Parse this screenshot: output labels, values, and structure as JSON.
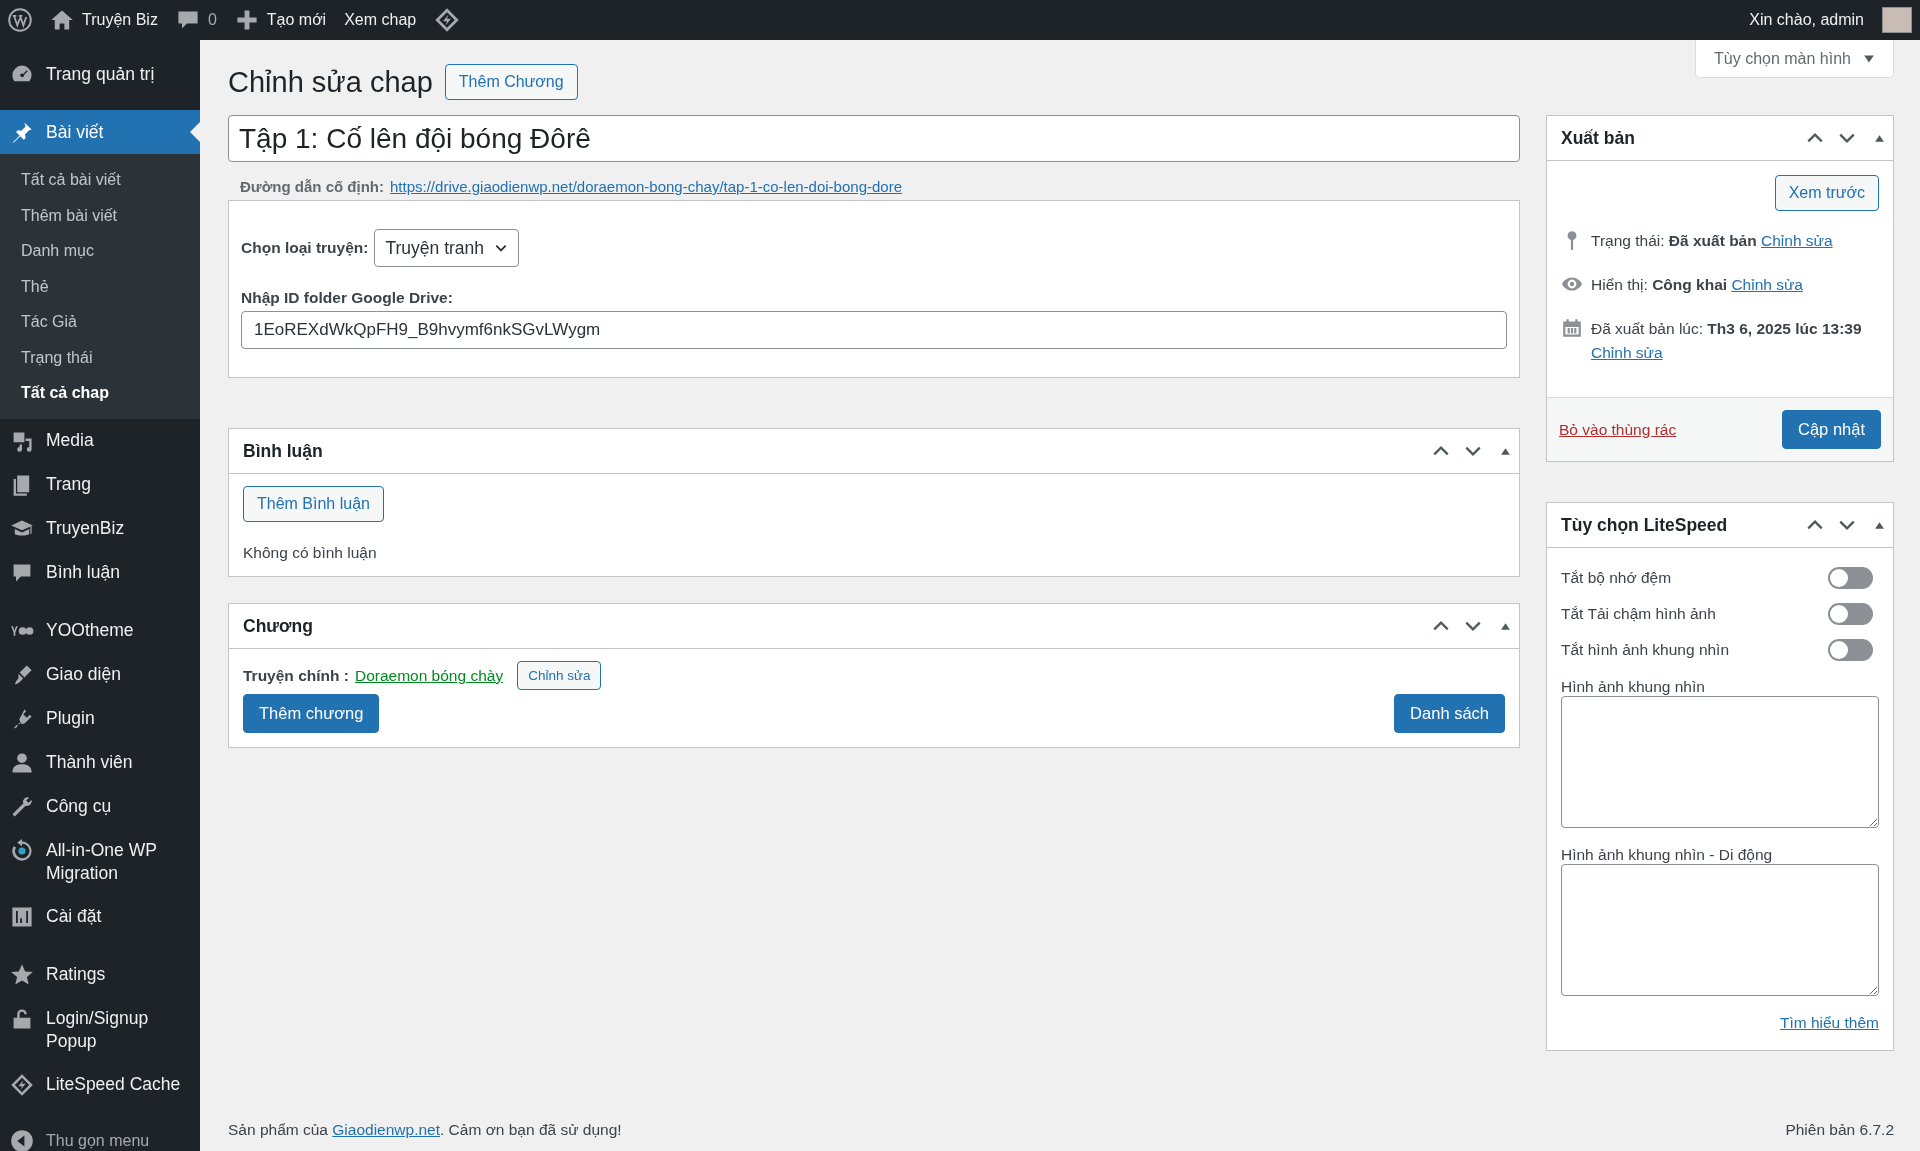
{
  "admin_bar": {
    "items": [
      {
        "label": "Truyện Biz"
      },
      {
        "label": "0"
      },
      {
        "label": "Tạo mới"
      },
      {
        "label": "Xem chap"
      }
    ],
    "greeting": "Xin chào, admin"
  },
  "sidebar": {
    "groups": [
      {
        "items": [
          {
            "label": "Trang quản trị",
            "selected": false
          }
        ]
      },
      {
        "items": [
          {
            "label": "Bài viết",
            "selected": true,
            "children": [
              {
                "label": "Tất cả bài viết",
                "selected": false
              },
              {
                "label": "Thêm bài viết",
                "selected": false
              },
              {
                "label": "Danh mục",
                "selected": false
              },
              {
                "label": "Thẻ",
                "selected": false
              },
              {
                "label": "Tác Giả",
                "selected": false
              },
              {
                "label": "Trạng thái",
                "selected": false
              },
              {
                "label": "Tất cả chap",
                "selected": true
              }
            ]
          },
          {
            "label": "Media",
            "selected": false
          },
          {
            "label": "Trang",
            "selected": false
          },
          {
            "label": "TruyenBiz",
            "selected": false
          },
          {
            "label": "Bình luận",
            "selected": false
          }
        ]
      },
      {
        "items": [
          {
            "label": "YOOtheme",
            "selected": false
          },
          {
            "label": "Giao diện",
            "selected": false
          },
          {
            "label": "Plugin",
            "selected": false
          },
          {
            "label": "Thành viên",
            "selected": false
          },
          {
            "label": "Công cụ",
            "selected": false
          },
          {
            "label": "All-in-One WP Migration",
            "selected": false
          },
          {
            "label": "Cài đặt",
            "selected": false
          }
        ]
      },
      {
        "items": [
          {
            "label": "Ratings",
            "selected": false
          },
          {
            "label": "Login/Signup Popup",
            "selected": false
          },
          {
            "label": "LiteSpeed Cache",
            "selected": false
          }
        ]
      }
    ],
    "collapse": "Thu gọn menu"
  },
  "screen_options": "Tùy chọn màn hình",
  "page": {
    "title": "Chỉnh sửa chap",
    "add_button": "Thêm Chương"
  },
  "post_title": "Tập 1: Cố lên đội bóng Đôrê",
  "permalink": {
    "label": "Đường dẫn cố định:",
    "url": "https://drive.giaodienwp.net/doraemon-bong-chay/tap-1-co-len-doi-bong-dore"
  },
  "custom_fields": {
    "type_label": "Chọn loại truyện:",
    "type_value": "Truyện tranh",
    "drive_label": "Nhập ID folder Google Drive:",
    "drive_value": "1EoREXdWkQpFH9_B9hvymf6nkSGvLWygm"
  },
  "comments_box": {
    "title": "Bình luận",
    "button": "Thêm Bình luận",
    "empty": "Không có bình luận"
  },
  "chapter_box": {
    "title": "Chương",
    "main_label": "Truyện chính :",
    "main_link": "Doraemon bóng chày",
    "edit_button": "Chỉnh sửa",
    "add_button": "Thêm chương",
    "list_button": "Danh sách"
  },
  "publish_box": {
    "title": "Xuất bản",
    "preview": "Xem trước",
    "rows": [
      {
        "text": "Trạng thái: **Đã xuất bản**",
        "link": "Chỉnh sửa"
      },
      {
        "text": "Hiển thị: **Công khai**",
        "link": "Chỉnh sửa"
      },
      {
        "text": "Đã xuất bản lúc: **Th3 6, 2025 lúc 13:39**",
        "link": "Chỉnh sửa"
      }
    ],
    "trash": "Bỏ vào thùng rác",
    "update": "Cập nhật"
  },
  "litespeed_box": {
    "title": "Tùy chọn LiteSpeed",
    "toggles": [
      {
        "label": "Tắt bộ nhớ đệm",
        "on": false
      },
      {
        "label": "Tắt Tải chậm hình ảnh",
        "on": false
      },
      {
        "label": "Tắt hình ảnh khung nhìn",
        "on": false
      }
    ],
    "textareas": [
      {
        "label": "Hình ảnh khung nhìn"
      },
      {
        "label": "Hình ảnh khung nhìn - Di động"
      }
    ],
    "learn_more": "Tìm hiểu thêm"
  },
  "footer": {
    "text_before": "Sản phẩm của",
    "link": "Giaodienwp.net",
    "text_after": ". Cảm ơn bạn đã sử dụng!",
    "version": "Phiên bản 6.7.2"
  }
}
